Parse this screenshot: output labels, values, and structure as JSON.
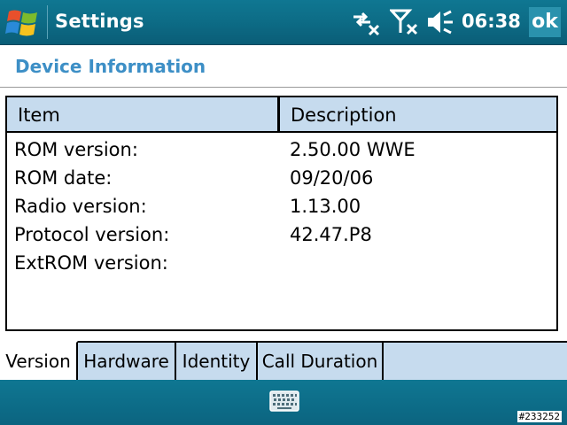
{
  "titlebar": {
    "title": "Settings",
    "clock": "06:38",
    "ok_label": "ok",
    "icons": [
      "windows-start-icon",
      "connectivity-off-icon",
      "signal-off-icon",
      "speaker-muted-icon"
    ]
  },
  "page": {
    "heading": "Device Information"
  },
  "list": {
    "columns": [
      "Item",
      "Description"
    ],
    "rows": [
      {
        "item": "ROM version:",
        "description": "2.50.00 WWE"
      },
      {
        "item": "ROM date:",
        "description": "09/20/06"
      },
      {
        "item": "Radio version:",
        "description": "1.13.00"
      },
      {
        "item": "Protocol version:",
        "description": "42.47.P8"
      },
      {
        "item": "ExtROM version:",
        "description": ""
      }
    ]
  },
  "tabs": [
    {
      "label": "Version",
      "active": true
    },
    {
      "label": "Hardware",
      "active": false
    },
    {
      "label": "Identity",
      "active": false
    },
    {
      "label": "Call Duration",
      "active": false
    }
  ],
  "menubar": {
    "icon": "keyboard-icon"
  },
  "watermark": "#233252",
  "colors": {
    "bar": "#0d6d87",
    "heading": "#3d8fc6",
    "header_fill": "#c6dbee"
  }
}
